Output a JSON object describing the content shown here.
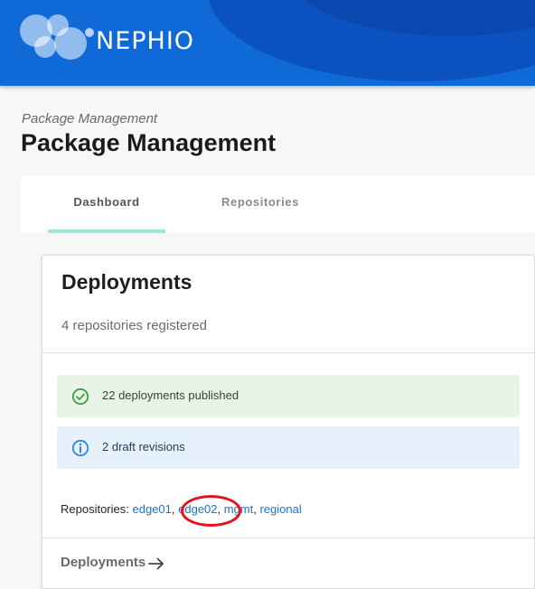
{
  "header": {
    "brand_name": "NEPHIO",
    "colors": {
      "primary": "#0f6ad8",
      "dark": "#0d4fb8"
    }
  },
  "page": {
    "breadcrumb": "Package Management",
    "title": "Package Management"
  },
  "tabs": [
    {
      "label": "Dashboard",
      "active": true
    },
    {
      "label": "Repositories",
      "active": false
    }
  ],
  "card": {
    "title": "Deployments",
    "subtitle": "4 repositories registered",
    "alerts": [
      {
        "type": "success",
        "icon": "check-circle-icon",
        "text": "22 deployments published"
      },
      {
        "type": "info",
        "icon": "info-circle-icon",
        "text": "2 draft revisions"
      }
    ],
    "repositories_label": "Repositories:",
    "repositories": [
      "edge01",
      "edge02",
      "mgmt",
      "regional"
    ],
    "footer_link": "Deployments"
  },
  "annotation": {
    "target": "edge02",
    "color": "#e8111e"
  }
}
